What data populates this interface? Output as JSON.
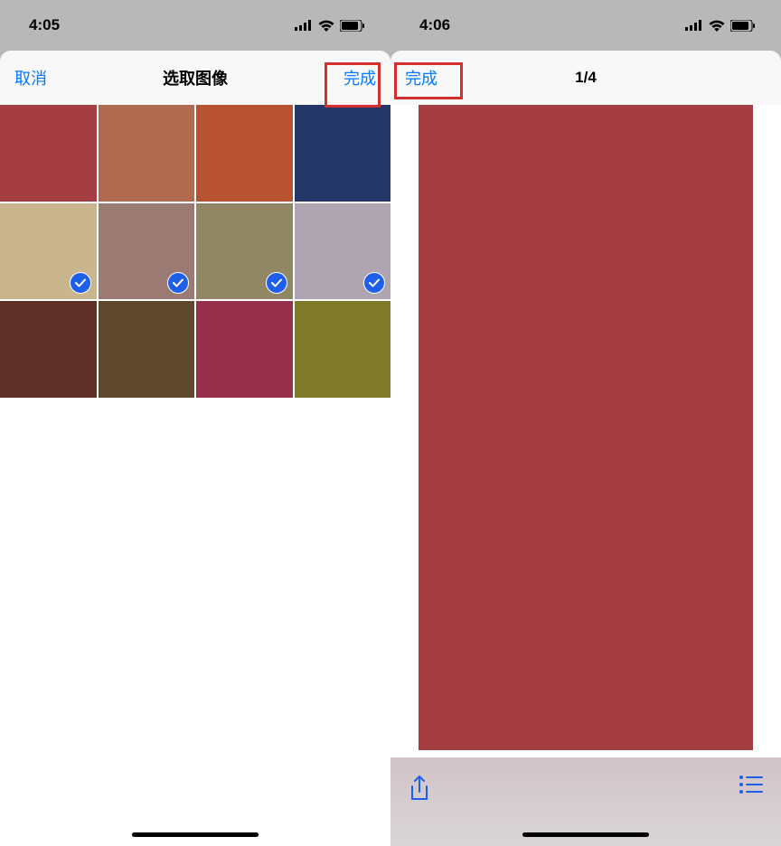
{
  "screen1": {
    "status": {
      "time": "4:05"
    },
    "nav": {
      "cancel": "取消",
      "title": "选取图像",
      "done": "完成"
    },
    "tiles": [
      {
        "color": "#a43e42",
        "selected": false
      },
      {
        "color": "#b06a4f",
        "selected": false
      },
      {
        "color": "#b75330",
        "selected": false
      },
      {
        "color": "#243767",
        "selected": false
      },
      {
        "color": "#c9b58e",
        "selected": true
      },
      {
        "color": "#9a7a73",
        "selected": true
      },
      {
        "color": "#918764",
        "selected": true
      },
      {
        "color": "#aea5b0",
        "selected": true
      },
      {
        "color": "#5e2f27",
        "selected": false
      },
      {
        "color": "#5e482d",
        "selected": false
      },
      {
        "color": "#96304a",
        "selected": false
      },
      {
        "color": "#7e7a2a",
        "selected": false
      }
    ]
  },
  "screen2": {
    "status": {
      "time": "4:06"
    },
    "nav": {
      "done": "完成",
      "counter": "1/4"
    },
    "preview_color": "#a43e42"
  }
}
